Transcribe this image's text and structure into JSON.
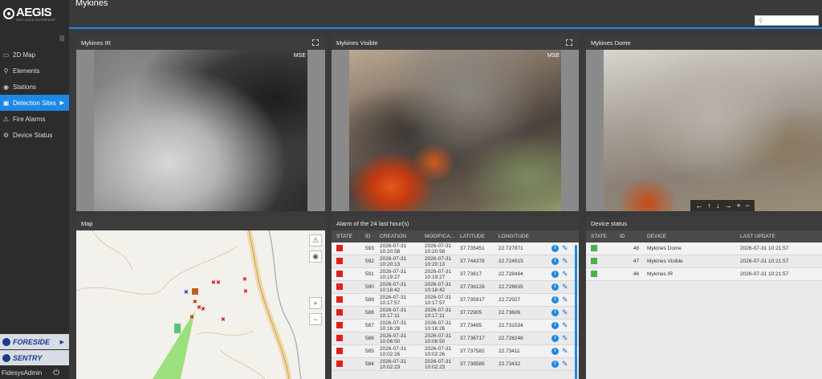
{
  "app": {
    "logo_name": "AEGIS",
    "logo_sub": "GEO-DATA INTERFACE",
    "page_title": "Mykines",
    "search_placeholder": ""
  },
  "sidebar": {
    "items": [
      {
        "label": "2D Map",
        "icon": "map-icon",
        "active": false
      },
      {
        "label": "Elements",
        "icon": "pin-icon",
        "active": false
      },
      {
        "label": "Stations",
        "icon": "target-icon",
        "active": false
      },
      {
        "label": "Detection Sites",
        "icon": "camera-icon",
        "active": true
      },
      {
        "label": "Fire Alarms",
        "icon": "warning-icon",
        "active": false
      },
      {
        "label": "Device Status",
        "icon": "device-icon",
        "active": false
      }
    ],
    "brands": [
      "FORESIDE",
      "SENTRY"
    ],
    "user": "FidesysAdmin"
  },
  "cameras": [
    {
      "title": "Mykines IR",
      "overlay": "MSE"
    },
    {
      "title": "Mykines Visible",
      "overlay": "MSE"
    },
    {
      "title": "Mykines Dome",
      "overlay": ""
    }
  ],
  "map": {
    "title": "Map"
  },
  "alarms": {
    "title": "Alarm of the 24 last hour(s)",
    "columns": [
      "STATE",
      "ID",
      "CREATION",
      "MODIFICA...",
      "LATITUDE",
      "LONGITUDE"
    ],
    "state_color": "#e02020",
    "rows": [
      {
        "id": "593",
        "creation": [
          "2026-07-31",
          "10:20:58"
        ],
        "modified": [
          "2026-07-31",
          "10:20:58"
        ],
        "lat": "37.735451",
        "lon": "22.727871"
      },
      {
        "id": "592",
        "creation": [
          "2026-07-31",
          "10:20:13"
        ],
        "modified": [
          "2026-07-31",
          "10:20:13"
        ],
        "lat": "37.744378",
        "lon": "22.724915"
      },
      {
        "id": "591",
        "creation": [
          "2026-07-31",
          "10:19:27"
        ],
        "modified": [
          "2026-07-31",
          "10:19:27"
        ],
        "lat": "37.73617",
        "lon": "22.728494"
      },
      {
        "id": "590",
        "creation": [
          "2026-07-31",
          "10:18:42"
        ],
        "modified": [
          "2026-07-31",
          "10:18:42"
        ],
        "lat": "37.736128",
        "lon": "22.728635"
      },
      {
        "id": "589",
        "creation": [
          "2026-07-31",
          "10:17:57"
        ],
        "modified": [
          "2026-07-31",
          "10:17:57"
        ],
        "lat": "37.735917",
        "lon": "22.72927"
      },
      {
        "id": "588",
        "creation": [
          "2026-07-31",
          "10:17:11"
        ],
        "modified": [
          "2026-07-31",
          "10:17:11"
        ],
        "lat": "37.72905",
        "lon": "22.73606"
      },
      {
        "id": "587",
        "creation": [
          "2026-07-31",
          "10:16:26"
        ],
        "modified": [
          "2026-07-31",
          "10:16:26"
        ],
        "lat": "37.73495",
        "lon": "22.731534"
      },
      {
        "id": "586",
        "creation": [
          "2026-07-31",
          "10:06:50"
        ],
        "modified": [
          "2026-07-31",
          "10:06:50"
        ],
        "lat": "37.736717",
        "lon": "22.728246"
      },
      {
        "id": "585",
        "creation": [
          "2026-07-31",
          "10:02:26"
        ],
        "modified": [
          "2026-07-31",
          "10:02:26"
        ],
        "lat": "37.737582",
        "lon": "22.73411"
      },
      {
        "id": "584",
        "creation": [
          "2026-07-31",
          "10:02:23"
        ],
        "modified": [
          "2026-07-31",
          "10:02:23"
        ],
        "lat": "37.738585",
        "lon": "22.73432"
      }
    ]
  },
  "devices": {
    "title": "Device status",
    "columns": [
      "STATE",
      "ID",
      "DEVICE",
      "LAST UPDATE"
    ],
    "state_color": "#4caf50",
    "rows": [
      {
        "id": "48",
        "device": "Mykines Dome",
        "updated": "2026-07-31 10:21:57"
      },
      {
        "id": "47",
        "device": "Mykines Visible",
        "updated": "2026-07-31 10:21:57"
      },
      {
        "id": "46",
        "device": "Mykines IR",
        "updated": "2026-07-31 10:21:57"
      }
    ]
  },
  "colors": {
    "accent": "#1e88e5",
    "alarm": "#e02020",
    "ok": "#4caf50"
  }
}
